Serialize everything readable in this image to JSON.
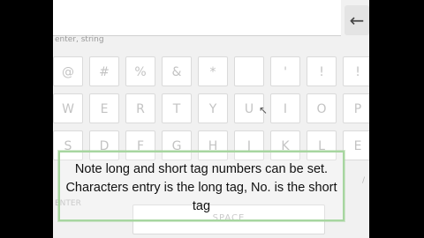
{
  "keyboard": {
    "hint_text": "enter, string",
    "backspace_icon": "←",
    "rows": [
      [
        "@",
        "#",
        "%",
        "&",
        "*",
        "",
        "'",
        "!",
        "!"
      ],
      [
        "W",
        "E",
        "R",
        "T",
        "Y",
        "U",
        "I",
        "O",
        "P"
      ],
      [
        "S",
        "D",
        "F",
        "G",
        "H",
        "J",
        "K",
        "L",
        "E"
      ]
    ],
    "space_label": "SPACE",
    "ghost_left": "ENTER",
    "ghost_right": "/"
  },
  "caption": {
    "text": "Note long and short tag numbers can be set. Characters entry is the long tag, No. is the short tag"
  },
  "icons": {
    "backspace": "arrow-left-icon",
    "cursor": "mouse-cursor-icon"
  }
}
